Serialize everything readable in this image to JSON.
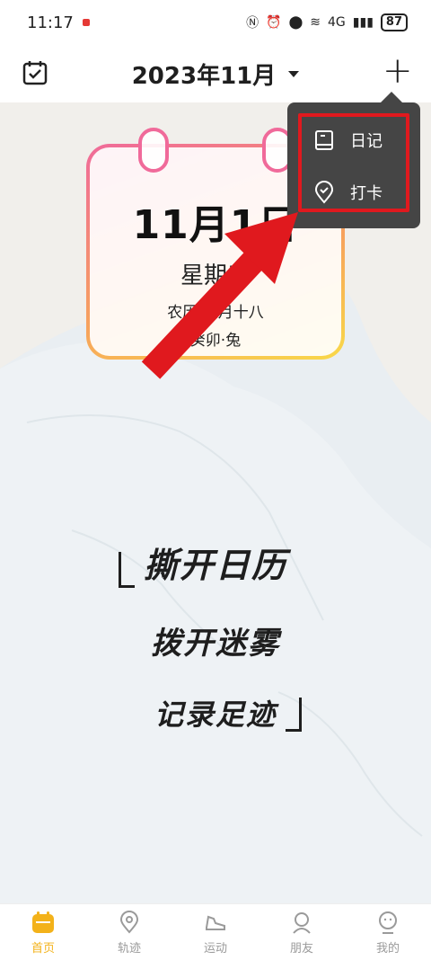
{
  "status_bar": {
    "time": "11:17",
    "signal": "4G",
    "battery": "87"
  },
  "header": {
    "title": "2023年11月",
    "calendar_icon": "calendar-check-icon",
    "add_icon": "plus-icon"
  },
  "card": {
    "date": "11月1日",
    "weekday": "星期三",
    "lunar": "农历 九月十八",
    "zodiac": "癸卯·兔"
  },
  "menu": {
    "items": [
      {
        "label": "日记",
        "icon": "book-icon"
      },
      {
        "label": "打卡",
        "icon": "location-check-icon"
      }
    ]
  },
  "slogans": {
    "line1": "撕开日历",
    "line2": "拨开迷雾",
    "line3": "记录足迹"
  },
  "bottom_nav": {
    "items": [
      {
        "label": "首页",
        "icon": "calendar-icon",
        "active": true
      },
      {
        "label": "轨迹",
        "icon": "map-pin-icon",
        "active": false
      },
      {
        "label": "运动",
        "icon": "shoe-icon",
        "active": false
      },
      {
        "label": "朋友",
        "icon": "friends-icon",
        "active": false
      },
      {
        "label": "我的",
        "icon": "profile-icon",
        "active": false
      }
    ]
  },
  "colors": {
    "accent": "#f3b21a",
    "highlight": "#e0191e",
    "menu_bg": "#454545",
    "card_gradient_start": "#f06a9a",
    "card_gradient_end": "#f9d949"
  }
}
